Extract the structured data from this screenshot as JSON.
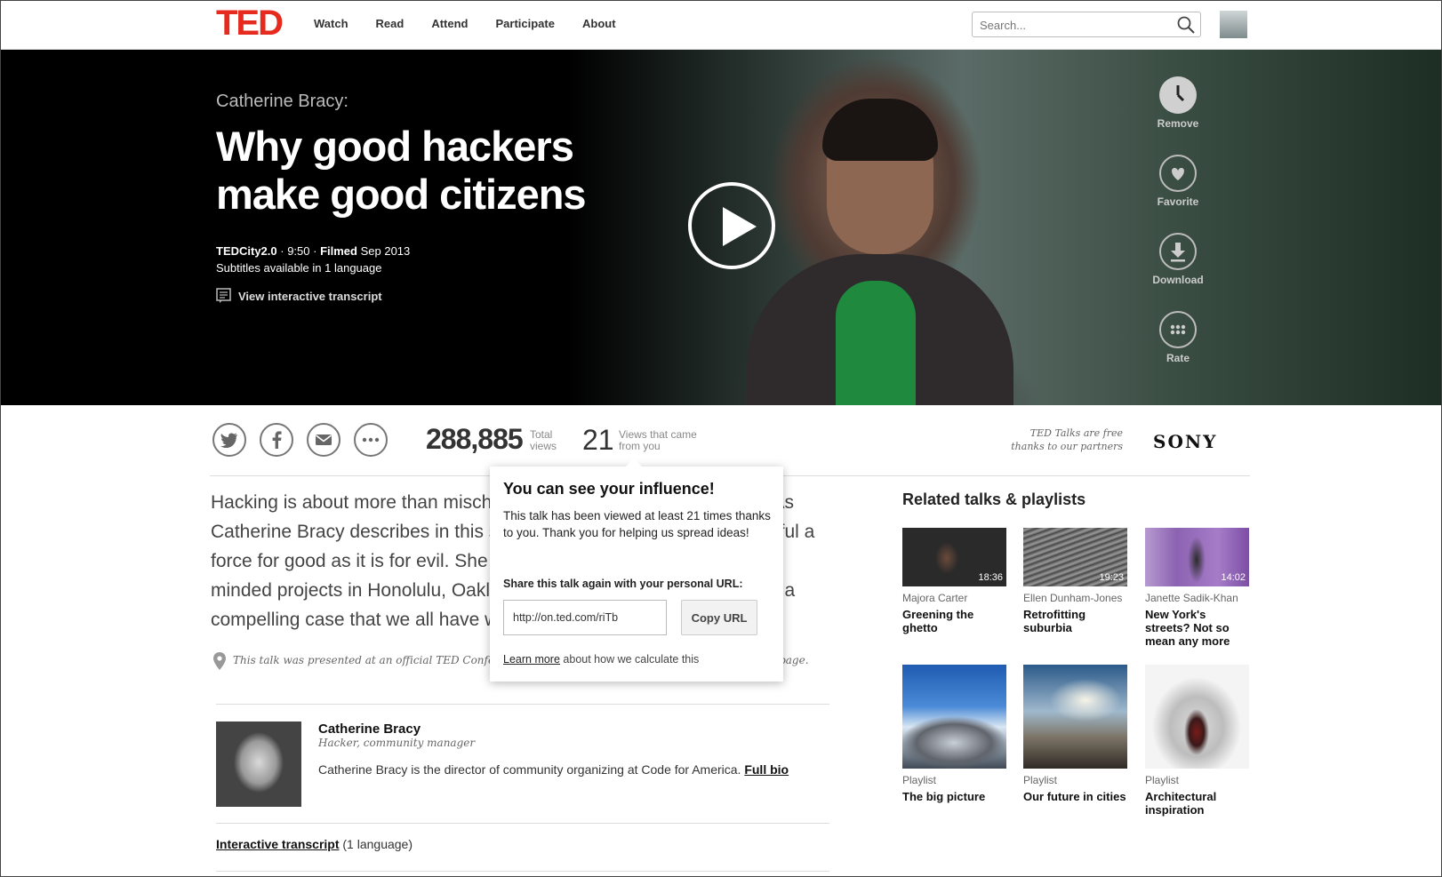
{
  "brand": {
    "logo": "TED",
    "accent": "#e62b1e"
  },
  "nav": [
    "Watch",
    "Read",
    "Attend",
    "Participate",
    "About"
  ],
  "search": {
    "placeholder": "Search..."
  },
  "talk": {
    "speaker": "Catherine Bracy:",
    "title": "Why good hackers make good citizens",
    "event": "TEDCity2.0",
    "duration": "9:50",
    "filmed_label": "Filmed",
    "filmed_date": "Sep 2013",
    "subtitles": "Subtitles available in 1 language",
    "transcript_link": "View interactive transcript"
  },
  "actions": [
    {
      "label": "Remove",
      "icon": "clock-icon"
    },
    {
      "label": "Favorite",
      "icon": "heart-icon"
    },
    {
      "label": "Download",
      "icon": "download-icon"
    },
    {
      "label": "Rate",
      "icon": "dots-icon"
    }
  ],
  "stats": {
    "total_views": "288,885",
    "total_label": "Total views",
    "your_views": "21",
    "your_label": "Views that came from you"
  },
  "partner": {
    "text": "TED Talks are free thanks to our partners",
    "logo": "SONY"
  },
  "description": "Hacking is about more than mischief-making or political subversion. As Catherine Bracy describes in this spirited talk, it can be just as powerful a force for good as it is for evil. She spotlights some inspiring civically-minded projects in Honolulu, Oakland and Mexico City — and makes a compelling case that we all have what it takes to pitch in.",
  "venue_note": "This talk was presented at an official TED Conference, and was featured by our editors on the home page.",
  "bio": {
    "name": "Catherine Bracy",
    "role": "Hacker, community manager",
    "text": "Catherine Bracy is the director of community organizing at Code for America.",
    "link": "Full bio"
  },
  "interactive": {
    "link": "Interactive transcript",
    "suffix": "(1 language)"
  },
  "popover": {
    "title": "You can see your influence!",
    "text": "This talk has been viewed at least 21 times thanks to you. Thank you for helping us spread ideas!",
    "share_label": "Share this talk again with your personal URL:",
    "url": "http://on.ted.com/riTb",
    "copy_button": "Copy URL",
    "learn_link": "Learn more",
    "learn_suffix": "about how we calculate this"
  },
  "related": {
    "title": "Related talks & playlists",
    "items": [
      {
        "sub": "Majora Carter",
        "title": "Greening the ghetto",
        "duration": "18:36"
      },
      {
        "sub": "Ellen Dunham-Jones",
        "title": "Retrofitting suburbia",
        "duration": "19:23"
      },
      {
        "sub": "Janette Sadik-Khan",
        "title": "New York's streets? Not so mean any more",
        "duration": "14:02"
      },
      {
        "sub": "Playlist",
        "title": "The big picture"
      },
      {
        "sub": "Playlist",
        "title": "Our future in cities"
      },
      {
        "sub": "Playlist",
        "title": "Architectural inspiration"
      }
    ]
  }
}
